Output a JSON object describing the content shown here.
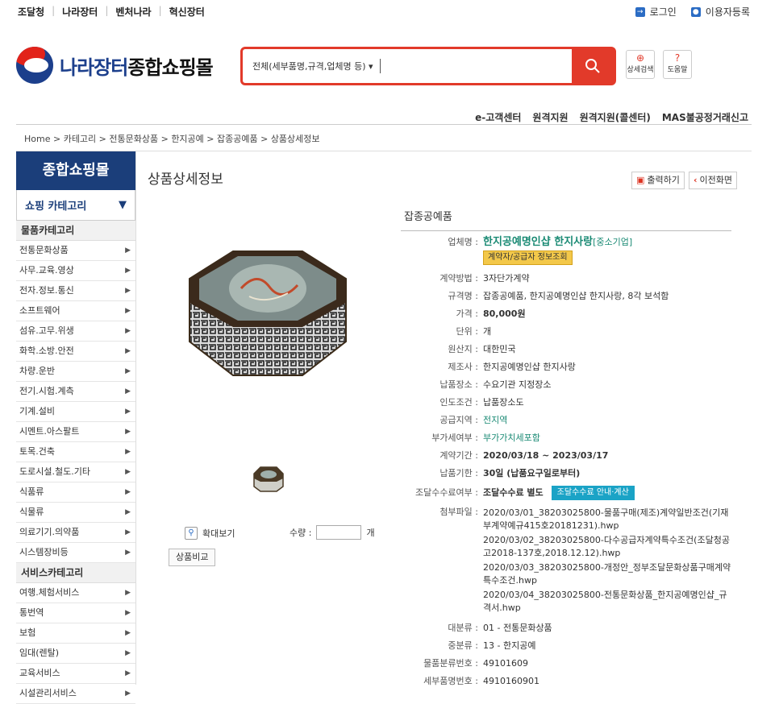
{
  "top_links": [
    "조달청",
    "나라장터",
    "벤처나라",
    "혁신장터"
  ],
  "user_links": {
    "login": "로그인",
    "register": "이용자등록"
  },
  "logo": {
    "part1": "나라장터",
    "part2": "종합쇼핑몰"
  },
  "search": {
    "scope": "전체(세부품명,규격,업체명 등)",
    "value": ""
  },
  "header_buttons": [
    {
      "label": "상세검색",
      "icon": "magnify-plus-icon"
    },
    {
      "label": "도움말",
      "icon": "question-icon"
    }
  ],
  "sub_nav": [
    "e-고객센터",
    "원격지원",
    "원격지원(콜센터)",
    "MAS불공정거래신고"
  ],
  "breadcrumb": "Home > 카테고리 > 전통문화상품 > 한지공예 > 잡종공예품 > 상품상세정보",
  "sidebar": {
    "title": "종합쇼핑몰",
    "subtitle": "쇼핑 카테고리",
    "group1_title": "물품카테고리",
    "group1_items": [
      "전통문화상품",
      "사무.교육.영상",
      "전자.정보.통신",
      "소프트웨어",
      "섬유.고무.위생",
      "화학.소방.안전",
      "차량.운반",
      "전기.시험.계측",
      "기계.설비",
      "시멘트.아스팔트",
      "토목.건축",
      "도로시설.철도.기타",
      "식품류",
      "식물류",
      "의료기기.의약품",
      "시스템장비등"
    ],
    "group2_title": "서비스카테고리",
    "group2_items": [
      "여행.체험서비스",
      "통번역",
      "보험",
      "임대(렌탈)",
      "교육서비스",
      "시설관리서비스"
    ]
  },
  "page": {
    "title": "상품상세정보",
    "print_btn": "출력하기",
    "back_btn": "이전화면",
    "zoom_label": "확대보기",
    "qty_label": "수량 :",
    "qty_unit": "개",
    "compare_btn": "상품비교"
  },
  "product": {
    "name": "잡종공예품",
    "vendor_label": "업체명",
    "vendor": "한지공예명인샵 한지사랑",
    "vendor_tag": "[중소기업]",
    "vendor_btn": "계약자/공급자 정보조회",
    "fields": [
      {
        "k": "계약방법",
        "v": "3자단가계약"
      },
      {
        "k": "규격명",
        "v": "잡종공예품, 한지공예명인샵 한지사랑, 8각 보석함"
      },
      {
        "k": "가격",
        "v": "80,000원"
      },
      {
        "k": "단위",
        "v": "개"
      },
      {
        "k": "원산지",
        "v": "대한민국"
      },
      {
        "k": "제조사",
        "v": "한지공예명인샵 한지사랑"
      },
      {
        "k": "납품장소",
        "v": "수요기관 지정장소"
      },
      {
        "k": "인도조건",
        "v": "납품장소도"
      },
      {
        "k": "공급지역",
        "v": "전지역"
      },
      {
        "k": "부가세여부",
        "v": "부가가치세포함"
      },
      {
        "k": "계약기간",
        "v": "2020/03/18 ~ 2023/03/17"
      },
      {
        "k": "납품기한",
        "v": "30일 (납품요구일로부터)"
      }
    ],
    "fee_label": "조달수수료여부",
    "fee_value": "조달수수료 별도",
    "fee_btn": "조달수수료 안내·계산",
    "files_label": "첨부파일",
    "files": [
      "2020/03/01_38203025800-물품구매(제조)계약일반조건(기재부계약예규415호20181231).hwp",
      "2020/03/02_38203025800-다수공급자계약특수조건(조달청공고2018-137호,2018.12.12).hwp",
      "2020/03/03_38203025800-개정안_정부조달문화상품구매계약특수조건.hwp",
      "2020/03/04_38203025800-전통문화상품_한지공예명인샵_규격서.hwp"
    ],
    "tail_fields": [
      {
        "k": "대분류",
        "v": "01 - 전통문화상품"
      },
      {
        "k": "중분류",
        "v": "13 - 한지공예"
      },
      {
        "k": "물품분류번호",
        "v": "49101609"
      },
      {
        "k": "세부품명번호",
        "v": "4910160901"
      }
    ]
  }
}
